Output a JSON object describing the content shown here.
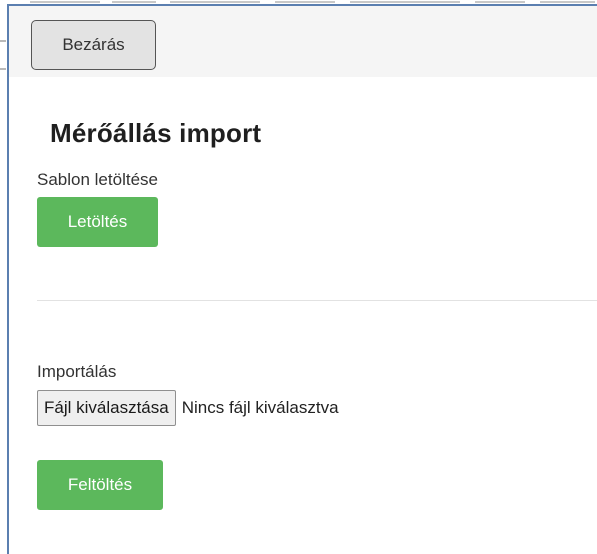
{
  "dialog": {
    "close_label": "Bezárás",
    "title": "Mérőállás import"
  },
  "template_section": {
    "label": "Sablon letöltése",
    "download_label": "Letöltés"
  },
  "import_section": {
    "label": "Importálás",
    "file_button_label": "Fájl kiválasztása",
    "file_status": "Nincs fájl kiválasztva",
    "upload_label": "Feltöltés"
  },
  "colors": {
    "accent_green": "#5cb85c",
    "dialog_border": "#5b7fb0",
    "header_bg": "#f5f5f5"
  }
}
